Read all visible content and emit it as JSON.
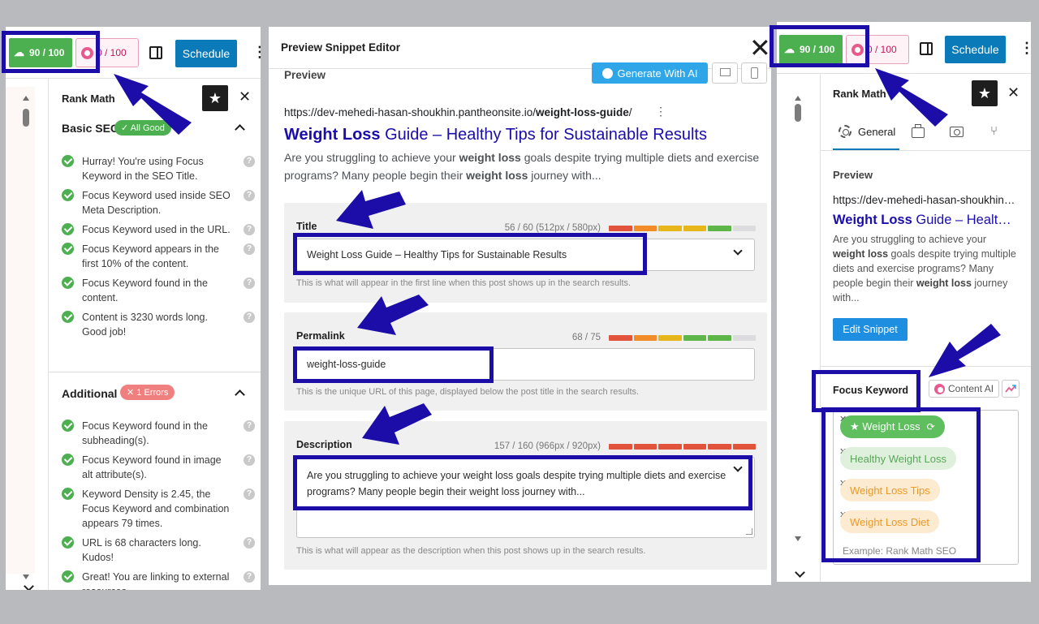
{
  "left": {
    "score_label": "90 / 100",
    "content_ai_score": "0 / 100",
    "schedule_label": "Schedule",
    "panel_title": "Rank Math",
    "basic_seo": {
      "title": "Basic SEO",
      "badge": "✓ All Good",
      "items": [
        "Hurray! You're using Focus Keyword in the SEO Title.",
        "Focus Keyword used inside SEO Meta Description.",
        "Focus Keyword used in the URL.",
        "Focus Keyword appears in the first 10% of the content.",
        "Focus Keyword found in the content.",
        "Content is 3230 words long. Good job!"
      ]
    },
    "additional": {
      "title": "Additional",
      "badge": "✕ 1 Errors",
      "items": [
        "Focus Keyword found in the subheading(s).",
        "Focus Keyword found in image alt attribute(s).",
        "Keyword Density is 2.45, the Focus Keyword and combination appears 79 times.",
        "URL is 68 characters long. Kudos!",
        "Great! You are linking to external resources."
      ]
    }
  },
  "modal": {
    "title": "Preview Snippet Editor",
    "preview_label": "Preview",
    "generate_ai_label": "Generate With AI",
    "serp": {
      "url_prefix": "https://dev-mehedi-hasan-shoukhin.pantheonsite.io/",
      "url_slug": "weight-loss-guide",
      "url_suffix": "/",
      "title_keyword": "Weight Loss",
      "title_rest": " Guide – Healthy Tips for Sustainable Results",
      "desc_1": "Are you struggling to achieve your ",
      "desc_kw1": "weight loss",
      "desc_2": " goals despite trying multiple diets and exercise programs? Many people begin their ",
      "desc_kw2": "weight loss",
      "desc_3": " journey with..."
    },
    "title_field": {
      "label": "Title",
      "count": "56 / 60 (512px / 580px)",
      "value": "Weight Loss Guide – Healthy Tips for Sustainable Results",
      "hint": "This is what will appear in the first line when this post shows up in the search results."
    },
    "permalink_field": {
      "label": "Permalink",
      "count": "68 / 75",
      "value": "weight-loss-guide",
      "hint": "This is the unique URL of this page, displayed below the post title in the search results."
    },
    "description_field": {
      "label": "Description",
      "count": "157 / 160 (966px / 920px)",
      "value": "Are you struggling to achieve your weight loss goals despite trying multiple diets and exercise programs? Many people begin their weight loss journey with...",
      "hint": "This is what will appear as the description when this post shows up in the search results."
    }
  },
  "right": {
    "score_label": "90 / 100",
    "content_ai_score": "0 / 100",
    "schedule_label": "Schedule",
    "panel_title": "Rank Math",
    "tab_general": "General",
    "preview_label": "Preview",
    "url": "https://dev-mehedi-hasan-shoukhin.pantheonsite.io/weight-loss-guide/",
    "title_keyword": "Weight Loss",
    "title_rest": " Guide – Healthy Tips for Sustainable Results",
    "desc_1": "Are you struggling to achieve your ",
    "desc_kw1": "weight loss",
    "desc_2": " goals despite trying multiple diets and exercise programs? Many people begin their ",
    "desc_kw2": "weight loss",
    "desc_3": " journey with...",
    "edit_snippet_label": "Edit Snippet",
    "focus_keyword_label": "Focus Keyword",
    "content_ai_label": "Content AI",
    "keywords": [
      "★ Weight Loss",
      "Healthy Weight Loss",
      "Weight Loss Tips",
      "Weight Loss Diet"
    ],
    "keyword_placeholder": "Example: Rank Math SEO"
  },
  "colors": {
    "annotation": "#1c0da8",
    "good_green": "#4caf50",
    "schedule_blue": "#0a7ab8",
    "serp_link": "#1a0dab",
    "meter_red": "#e2533c",
    "meter_orange": "#f28c28",
    "meter_yellow": "#e6b61a",
    "meter_green": "#5eb548",
    "meter_empty": "#dcdcde"
  }
}
